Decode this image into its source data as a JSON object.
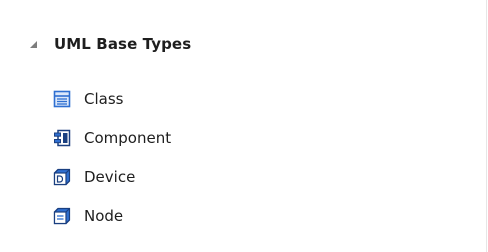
{
  "toolbox": {
    "group": {
      "title": "UML Base Types",
      "expanded": true,
      "toggle_icon": "expanded-triangle-icon"
    },
    "items": [
      {
        "label": "Class",
        "icon": "class-icon"
      },
      {
        "label": "Component",
        "icon": "component-icon"
      },
      {
        "label": "Device",
        "icon": "device-icon"
      },
      {
        "label": "Node",
        "icon": "node-icon"
      }
    ]
  },
  "colors": {
    "icon_blue": "#2f6fd1",
    "icon_light": "#dbe8fb",
    "icon_dark": "#1a3f80",
    "text": "#1e1e1e"
  }
}
